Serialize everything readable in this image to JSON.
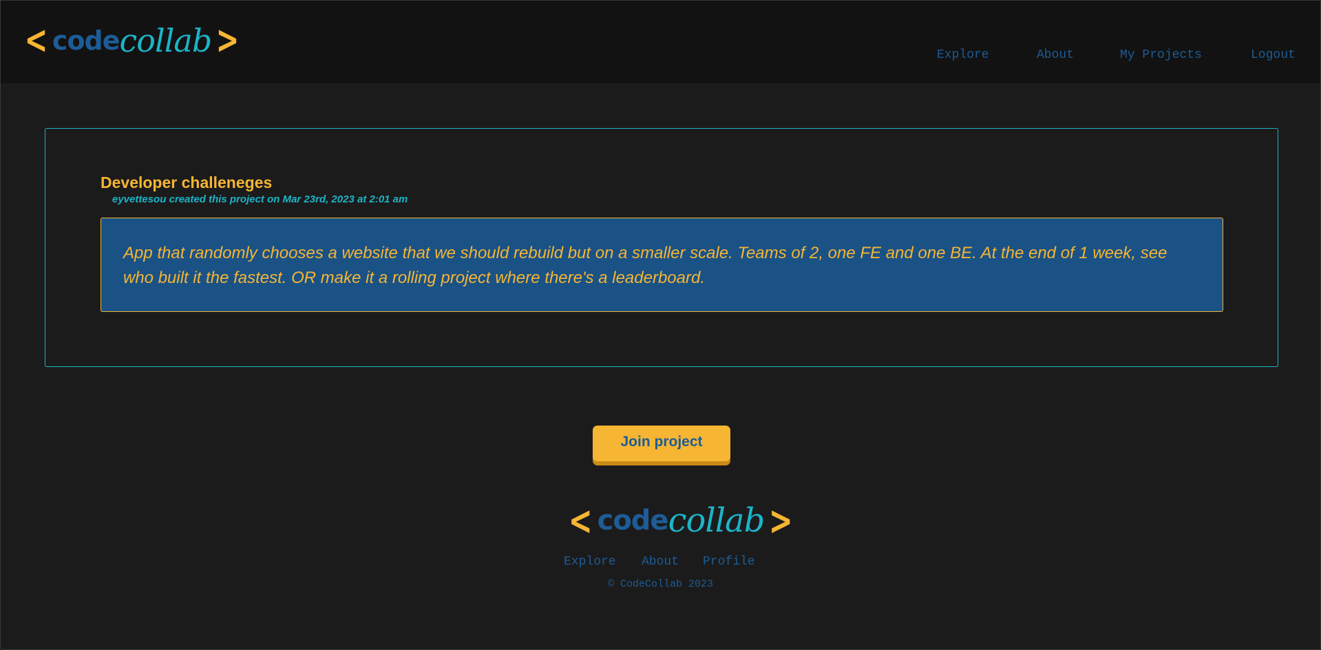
{
  "brand": {
    "bracket_open": "<",
    "name_part1": "code",
    "name_part2": "collab",
    "bracket_close": ">",
    "colors": {
      "accent_yellow": "#f6b533",
      "brand_blue": "#1d5c96",
      "brand_teal": "#1cb4c8",
      "background": "#1b1b1b",
      "header_background": "#121212",
      "description_background": "#1a5286"
    }
  },
  "header": {
    "nav": [
      {
        "label": "Explore"
      },
      {
        "label": "About"
      },
      {
        "label": "My Projects"
      },
      {
        "label": "Logout"
      }
    ]
  },
  "project": {
    "title": "Developer challeneges",
    "meta": "eyvettesou created this project on Mar 23rd, 2023 at 2:01 am",
    "description": "App that randomly chooses a website that we should rebuild but on a smaller scale. Teams of 2, one FE and one BE. At the end of 1 week, see who built it the fastest. OR make it a rolling project where there's a leaderboard."
  },
  "actions": {
    "join_label": "Join project"
  },
  "footer": {
    "nav": [
      {
        "label": "Explore"
      },
      {
        "label": "About"
      },
      {
        "label": "Profile"
      }
    ],
    "copyright": "© CodeCollab 2023"
  }
}
